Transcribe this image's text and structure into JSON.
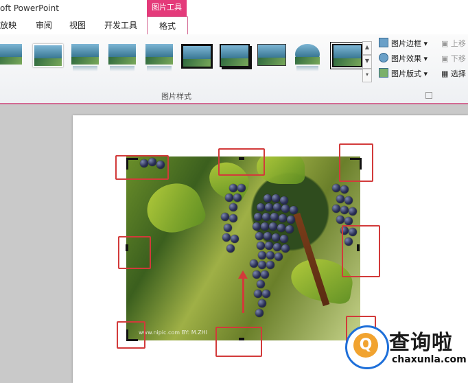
{
  "window": {
    "title": "oft PowerPoint"
  },
  "ribbon": {
    "context_tab": "图片工具",
    "tabs": [
      "放映",
      "审阅",
      "视图",
      "开发工具"
    ],
    "active_tab": "格式",
    "group_label": "图片样式",
    "menu_items": [
      {
        "label": "图片边框",
        "icon": "picture-border-icon"
      },
      {
        "label": "图片效果",
        "icon": "picture-effects-icon"
      },
      {
        "label": "图片版式",
        "icon": "picture-layout-icon"
      }
    ],
    "arrange_items": [
      {
        "label": "上移",
        "icon": "bring-forward-icon",
        "enabled": false
      },
      {
        "label": "下移",
        "icon": "send-backward-icon",
        "enabled": false
      },
      {
        "label": "选择",
        "icon": "selection-pane-icon",
        "enabled": true
      }
    ]
  },
  "slide": {
    "photo_caption": "www.nipic.com   BY: M.ZHI"
  },
  "watermark": {
    "chinese": "查询啦",
    "domain": "chaxunla.com",
    "logo_letter": "Q"
  },
  "colors": {
    "context_tab": "#e43a7a",
    "annotation": "#d23a3a",
    "watermark_blue": "#1e6fd9",
    "watermark_orange": "#f1a330"
  }
}
